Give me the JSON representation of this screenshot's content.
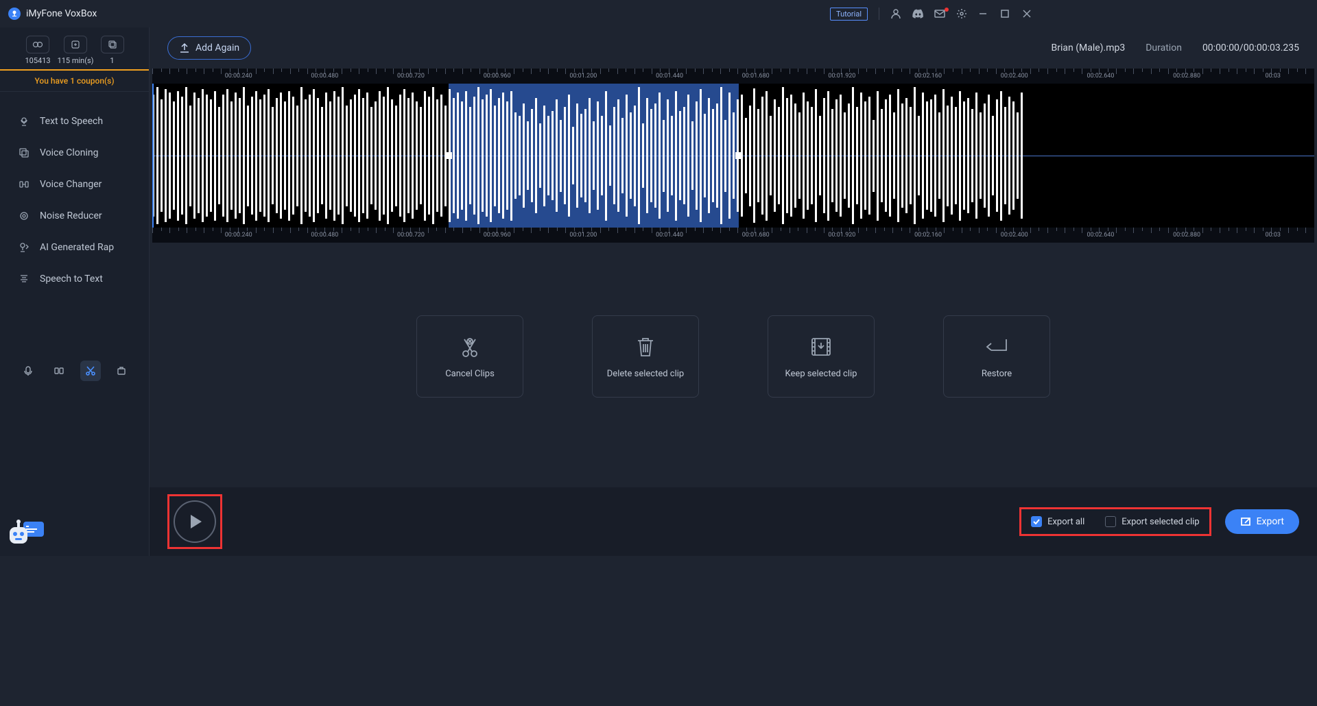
{
  "app_title": "iMyFone VoxBox",
  "titlebar": {
    "tutorial": "Tutorial"
  },
  "stats": [
    {
      "icon": "chars",
      "value": "105413"
    },
    {
      "icon": "time",
      "value": "115 min(s)"
    },
    {
      "icon": "copy",
      "value": "1"
    }
  ],
  "coupon": "You have 1 coupon(s)",
  "nav": [
    {
      "label": "Text to Speech",
      "icon": "tts"
    },
    {
      "label": "Voice Cloning",
      "icon": "clone"
    },
    {
      "label": "Voice Changer",
      "icon": "changer"
    },
    {
      "label": "Noise Reducer",
      "icon": "noise"
    },
    {
      "label": "AI Generated Rap",
      "icon": "rap"
    },
    {
      "label": "Speech to Text",
      "icon": "stt"
    }
  ],
  "toolbar": {
    "add_again": "Add Again"
  },
  "file": {
    "name": "Brian (Male).mp3",
    "duration_label": "Duration",
    "duration_value": "00:00:00/00:00:03.235"
  },
  "ruler_times": [
    "00:00.240",
    "00:00.480",
    "00:00.720",
    "00:00.960",
    "00:01.200",
    "00:01.440",
    "00:01.680",
    "00:01.920",
    "00:02.160",
    "00:02.400",
    "00:02.640",
    "00:02.880",
    "00:03"
  ],
  "selection": {
    "start_pct": 25.5,
    "end_pct": 50.5
  },
  "playhead_pct": 0,
  "actions": [
    {
      "label": "Cancel Clips",
      "icon": "cancel"
    },
    {
      "label": "Delete selected clip",
      "icon": "delete"
    },
    {
      "label": "Keep selected clip",
      "icon": "keep"
    },
    {
      "label": "Restore",
      "icon": "restore"
    }
  ],
  "export": {
    "all": "Export all",
    "selected": "Export selected clip",
    "button": "Export",
    "all_checked": true,
    "selected_checked": false
  }
}
